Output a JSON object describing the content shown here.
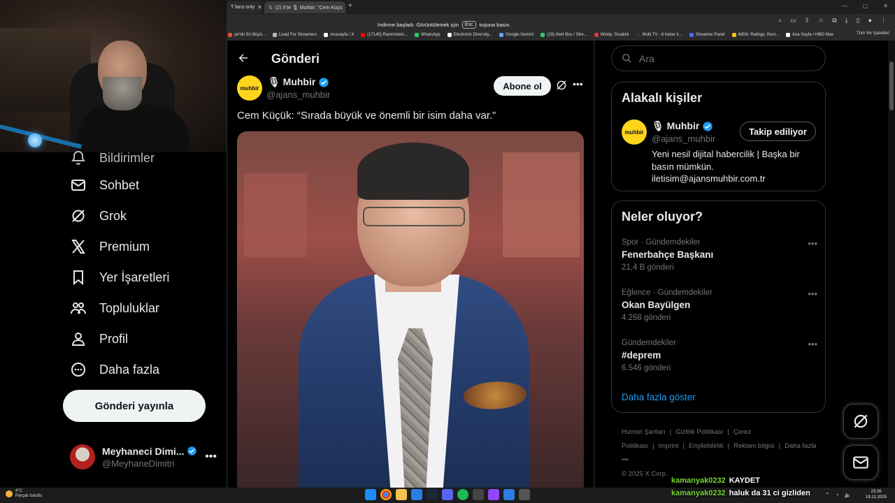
{
  "browser": {
    "tabs": [
      {
        "label": "T fans only"
      },
      {
        "label": "(2) X'te 🎙 Muhbir: \"Cem Küçü"
      }
    ],
    "fullscreen_notice": {
      "before": "İndirme başladı. Görüntülemek için",
      "key": "Esc",
      "after": "tuşuna basın."
    },
    "bookmarks": [
      {
        "label": "ye'nin En Büyü...",
        "color": "#e54b3c"
      },
      {
        "label": "Livad For Streamers",
        "color": "#bbbbbb"
      },
      {
        "label": "Anasayfa / X",
        "color": "#ffffff"
      },
      {
        "label": "(17145) Rammstein...",
        "color": "#ff0000"
      },
      {
        "label": "WhatsApp",
        "color": "#25d366"
      },
      {
        "label": "Electronic Diversity...",
        "color": "#ffffff"
      },
      {
        "label": "Google Gemini",
        "color": "#6aa0ff"
      },
      {
        "label": "(19) Alert Box / Stre...",
        "color": "#2ecc71"
      },
      {
        "label": "Windy: Sıcaklık",
        "color": "#e03a3a"
      },
      {
        "label": "Multi TV - 6 haber k...",
        "color": "#333333"
      },
      {
        "label": "Streamer Panel",
        "color": "#4a6cf7"
      },
      {
        "label": "IMDb: Ratings, Revi...",
        "color": "#f5c518"
      },
      {
        "label": "Ana Sayfa • HBO Max",
        "color": "#ffffff"
      }
    ],
    "all_bookmarks": "Tüm Yer İşaretleri"
  },
  "sidebar": {
    "items": [
      {
        "label": "Bildirimler",
        "icon": "bell-icon"
      },
      {
        "label": "Sohbet",
        "icon": "mail-icon"
      },
      {
        "label": "Grok",
        "icon": "grok-icon"
      },
      {
        "label": "Premium",
        "icon": "x-logo-icon"
      },
      {
        "label": "Yer İşaretleri",
        "icon": "bookmark-icon"
      },
      {
        "label": "Topluluklar",
        "icon": "people-icon"
      },
      {
        "label": "Profil",
        "icon": "person-icon"
      },
      {
        "label": "Daha fazla",
        "icon": "more-circle-icon"
      }
    ],
    "post_button": "Gönderi yayınla",
    "account": {
      "name": "Meyhaneci Dimi...",
      "handle": "@MeyhaneDimitri",
      "more": "•••"
    }
  },
  "main": {
    "title": "Gönderi",
    "author": {
      "avatar_text": "muhbir",
      "name": "🎙 Muhbir",
      "handle": "@ajans_muhbir"
    },
    "subscribe": "Abone ol",
    "more": "•••",
    "text": "Cem Küçük: “Sırada büyük ve önemli bir isim daha var.”"
  },
  "right": {
    "search_placeholder": "Ara",
    "related": {
      "title": "Alakalı kişiler",
      "avatar_text": "muhbir",
      "name": "🎙 Muhbir",
      "handle": "@ajans_muhbir",
      "follow": "Takip ediliyor",
      "bio": "Yeni nesil dijital habercilik | Başka bir basın mümkün. iletisim@ajansmuhbir.com.tr"
    },
    "trends": {
      "title": "Neler oluyor?",
      "items": [
        {
          "category": "Spor · Gündemdekiler",
          "name": "Fenerbahçe Başkanı",
          "count": "21,4 B gönderi"
        },
        {
          "category": "Eğlence · Gündemdekiler",
          "name": "Okan Bayülgen",
          "count": "4.268 gönderi"
        },
        {
          "category": "Gündemdekiler",
          "name": "#deprem",
          "count": "6.546 gönderi"
        }
      ],
      "show_more": "Daha fazla göster"
    },
    "footer": {
      "links": [
        "Hizmet Şartları",
        "|",
        "Gizlilik Politikası",
        "|",
        "Çerez Politikası",
        "|",
        "Imprint",
        "|",
        "Erişilebilirlik",
        "|",
        "Reklam bilgisi",
        "|",
        "Daha fazla •••"
      ],
      "copyright": "© 2025 X Corp."
    }
  },
  "chat": [
    {
      "user": "kamanyak0232",
      "message": "KAYDET"
    },
    {
      "user": "kamanyak0232",
      "message": "haluk da 31 ci gizliden"
    }
  ],
  "taskbar": {
    "weather_temp": "4°C",
    "weather_desc": "Parçalı bulutlu",
    "time": "23:26",
    "date": "19.12.2025"
  },
  "colors": {
    "accent": "#1d9bf0",
    "verified": "#1d9bf0",
    "chat_user": "#7bd33a"
  }
}
